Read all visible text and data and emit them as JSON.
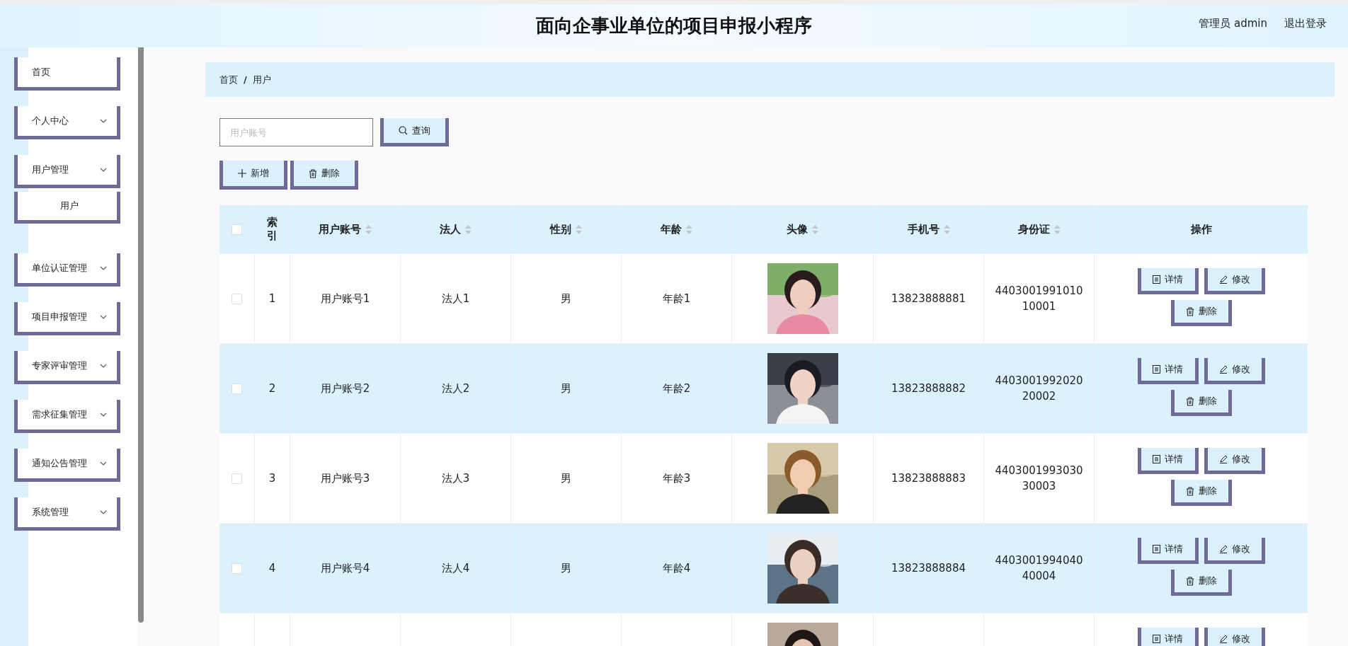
{
  "header": {
    "title": "面向企事业单位的项目申报小程序",
    "user_label": "管理员 admin",
    "logout": "退出登录"
  },
  "sidebar": {
    "items": [
      {
        "label": "首页",
        "kind": "link"
      },
      {
        "label": "个人中心",
        "kind": "submenu"
      },
      {
        "label": "用户管理",
        "kind": "submenu",
        "children": [
          {
            "label": "用户"
          }
        ]
      },
      {
        "label": "单位认证管理",
        "kind": "submenu"
      },
      {
        "label": "项目申报管理",
        "kind": "submenu"
      },
      {
        "label": "专家评审管理",
        "kind": "submenu"
      },
      {
        "label": "需求征集管理",
        "kind": "submenu"
      },
      {
        "label": "通知公告管理",
        "kind": "submenu"
      },
      {
        "label": "系统管理",
        "kind": "submenu"
      }
    ]
  },
  "breadcrumb": {
    "items": [
      "首页",
      "用户"
    ],
    "separator": "/"
  },
  "search": {
    "placeholder": "用户账号",
    "button": "查询"
  },
  "actions": [
    {
      "label": "新增",
      "kind": "add"
    },
    {
      "label": "删除",
      "kind": "delete"
    }
  ],
  "table": {
    "select_all": {
      "checked": false
    },
    "columns": [
      {
        "label": "索引",
        "sortable": false
      },
      {
        "label": "用户账号",
        "sortable": true
      },
      {
        "label": "法人",
        "sortable": true
      },
      {
        "label": "性别",
        "sortable": true
      },
      {
        "label": "年龄",
        "sortable": true
      },
      {
        "label": "头像",
        "sortable": true
      },
      {
        "label": "手机号",
        "sortable": true
      },
      {
        "label": "身份证",
        "sortable": true
      },
      {
        "label": "操作",
        "sortable": false
      }
    ],
    "rows": [
      {
        "checked": false,
        "index": "1",
        "account": "用户账号1",
        "legal_person": "法人1",
        "gender": "男",
        "age": "年龄1",
        "avatar": {
          "kind": "picture"
        },
        "phone": "13823888881",
        "id_card": "440300199101010001",
        "actions": [
          {
            "label": "详情",
            "kind": "detail"
          },
          {
            "label": "修改",
            "kind": "edit"
          },
          {
            "label": "删除",
            "kind": "delete"
          }
        ]
      },
      {
        "checked": false,
        "index": "2",
        "account": "用户账号2",
        "legal_person": "法人2",
        "gender": "男",
        "age": "年龄2",
        "avatar": {
          "kind": "picture"
        },
        "phone": "13823888882",
        "id_card": "440300199202020002",
        "actions": [
          {
            "label": "详情",
            "kind": "detail"
          },
          {
            "label": "修改",
            "kind": "edit"
          },
          {
            "label": "删除",
            "kind": "delete"
          }
        ]
      },
      {
        "checked": false,
        "index": "3",
        "account": "用户账号3",
        "legal_person": "法人3",
        "gender": "男",
        "age": "年龄3",
        "avatar": {
          "kind": "picture"
        },
        "phone": "13823888883",
        "id_card": "440300199303030003",
        "actions": [
          {
            "label": "详情",
            "kind": "detail"
          },
          {
            "label": "修改",
            "kind": "edit"
          },
          {
            "label": "删除",
            "kind": "delete"
          }
        ]
      },
      {
        "checked": false,
        "index": "4",
        "account": "用户账号4",
        "legal_person": "法人4",
        "gender": "男",
        "age": "年龄4",
        "avatar": {
          "kind": "picture"
        },
        "phone": "13823888884",
        "id_card": "440300199404040004",
        "actions": [
          {
            "label": "详情",
            "kind": "detail"
          },
          {
            "label": "修改",
            "kind": "edit"
          },
          {
            "label": "删除",
            "kind": "delete"
          }
        ]
      },
      {
        "avatar": {
          "kind": "picture"
        },
        "actions": [
          {
            "label": "详情",
            "kind": "detail"
          },
          {
            "label": "修改",
            "kind": "edit"
          }
        ]
      }
    ]
  }
}
